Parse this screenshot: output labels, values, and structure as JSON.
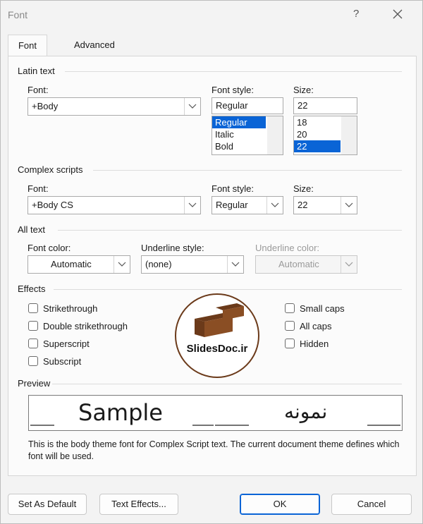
{
  "window": {
    "title": "Font",
    "help": "?"
  },
  "tabs": [
    {
      "label": "Font"
    },
    {
      "label": "Advanced"
    }
  ],
  "latin": {
    "group": "Latin text",
    "font_label": "Font:",
    "font_value": "+Body",
    "style_label": "Font style:",
    "style_value": "Regular",
    "style_options": [
      "Regular",
      "Italic",
      "Bold"
    ],
    "size_label": "Size:",
    "size_value": "22",
    "size_options": [
      "18",
      "20",
      "22"
    ]
  },
  "complex": {
    "group": "Complex scripts",
    "font_label": "Font:",
    "font_value": "+Body CS",
    "style_label": "Font style:",
    "style_value": "Regular",
    "size_label": "Size:",
    "size_value": "22"
  },
  "alltext": {
    "group": "All text",
    "color_label": "Font color:",
    "color_value": "Automatic",
    "underline_label": "Underline style:",
    "underline_value": "(none)",
    "ucolor_label": "Underline color:",
    "ucolor_value": "Automatic"
  },
  "effects": {
    "group": "Effects",
    "left": [
      "Strikethrough",
      "Double strikethrough",
      "Superscript",
      "Subscript"
    ],
    "right": [
      "Small caps",
      "All caps",
      "Hidden"
    ]
  },
  "logo_text": "SlidesDoc.ir",
  "preview": {
    "group": "Preview",
    "sample": "Sample",
    "sample_rtl": "نمونه",
    "description": "This is the body theme font for Complex Script text. The current document theme defines which font will be used."
  },
  "buttons": {
    "set_default": "Set As Default",
    "text_effects": "Text Effects...",
    "ok": "OK",
    "cancel": "Cancel"
  },
  "colors": {
    "accent": "#0a64d6",
    "logo_brown": "#6b3a1a"
  }
}
